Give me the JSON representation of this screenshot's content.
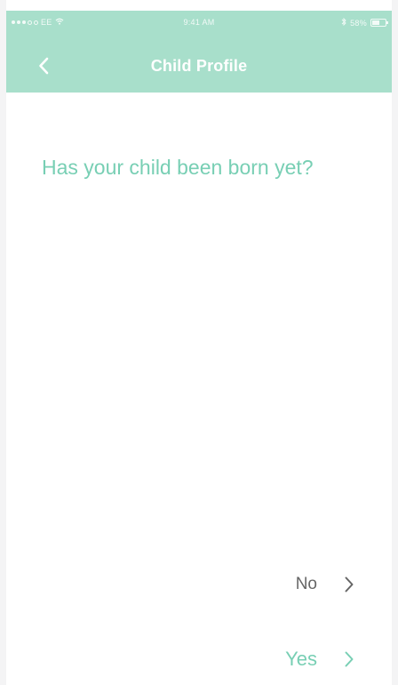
{
  "status_bar": {
    "carrier": "EE",
    "time": "9:41 AM",
    "battery_text": "58%",
    "battery_level": 0.58
  },
  "nav": {
    "title": "Child Profile",
    "back_icon": "chevron-left-icon"
  },
  "question": {
    "text": "Has your child been born yet?"
  },
  "options": [
    {
      "label": "No",
      "icon": "chevron-right-icon",
      "color": "#666666"
    },
    {
      "label": "Yes",
      "icon": "chevron-right-icon",
      "color": "#78cfb4"
    }
  ],
  "colors": {
    "header": "#a8dfcb",
    "accent": "#78cfb4",
    "background": "#ffffff"
  }
}
